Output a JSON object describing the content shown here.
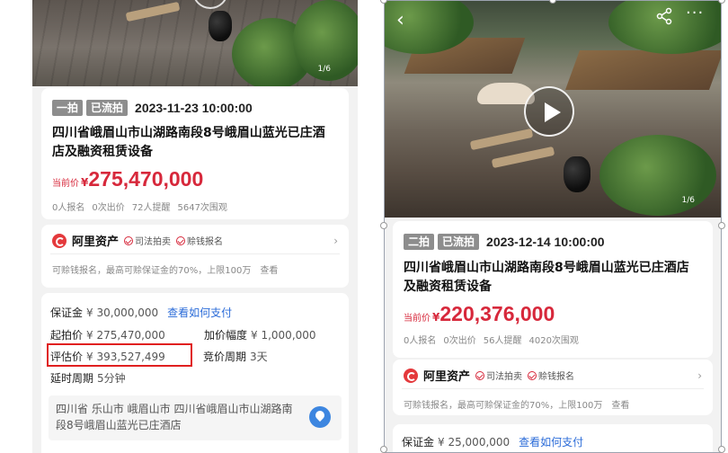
{
  "left": {
    "image_counter": "1/6",
    "tag_round": "一拍",
    "tag_status": "已流拍",
    "auction_time": "2023-11-23 10:00:00",
    "title": "四川省峨眉山市山湖路南段8号峨眉山蓝光已庄酒店及融资租赁设备",
    "price_label": "当前价",
    "price_currency": "¥",
    "price_value": "275,470,000",
    "stats": [
      "0人报名",
      "0次出价",
      "72人提醒",
      "5647次围观"
    ],
    "ali": {
      "name": "阿里资产",
      "badge1": "司法拍卖",
      "badge2": "赊钱报名",
      "sub_text": "可赊钱报名，最高可赊保证金的70%，上限100万",
      "sub_link": "查看"
    },
    "deposit": {
      "deposit_label": "保证金",
      "deposit_value": "¥ 30,000,000",
      "deposit_link": "查看如何支付",
      "start_label": "起拍价",
      "start_value": "¥ 275,470,000",
      "increment_label": "加价幅度",
      "increment_value": "¥ 1,000,000",
      "appraisal_label": "评估价",
      "appraisal_value": "¥ 393,527,499",
      "bid_period_label": "竞价周期",
      "bid_period_value": "3天",
      "delay_label": "延时周期",
      "delay_value": "5分钟",
      "address": "四川省 乐山市 峨眉山市 四川省峨眉山市山湖路南段8号峨眉山蓝光已庄酒店"
    }
  },
  "right": {
    "image_counter": "1/6",
    "tag_round": "二拍",
    "tag_status": "已流拍",
    "auction_time": "2023-12-14 10:00:00",
    "title": "四川省峨眉山市山湖路南段8号峨眉山蓝光已庄酒店及融资租赁设备",
    "price_label": "当前价",
    "price_currency": "¥",
    "price_value": "220,376,000",
    "stats": [
      "0人报名",
      "0次出价",
      "56人提醒",
      "4020次围观"
    ],
    "ali": {
      "name": "阿里资产",
      "badge1": "司法拍卖",
      "badge2": "赊钱报名",
      "sub_text": "可赊钱报名，最高可赊保证金的70%，上限100万",
      "sub_link": "查看"
    },
    "deposit": {
      "deposit_label": "保证金",
      "deposit_value": "¥ 25,000,000",
      "deposit_link": "查看如何支付"
    }
  },
  "colors": {
    "price_red": "#d7283b",
    "link_blue": "#2a6bd8",
    "highlight_red": "#e02020",
    "tag_gray": "#8d8d8d"
  },
  "icons": {
    "back": "‹",
    "more": "···",
    "chevron": "›"
  }
}
